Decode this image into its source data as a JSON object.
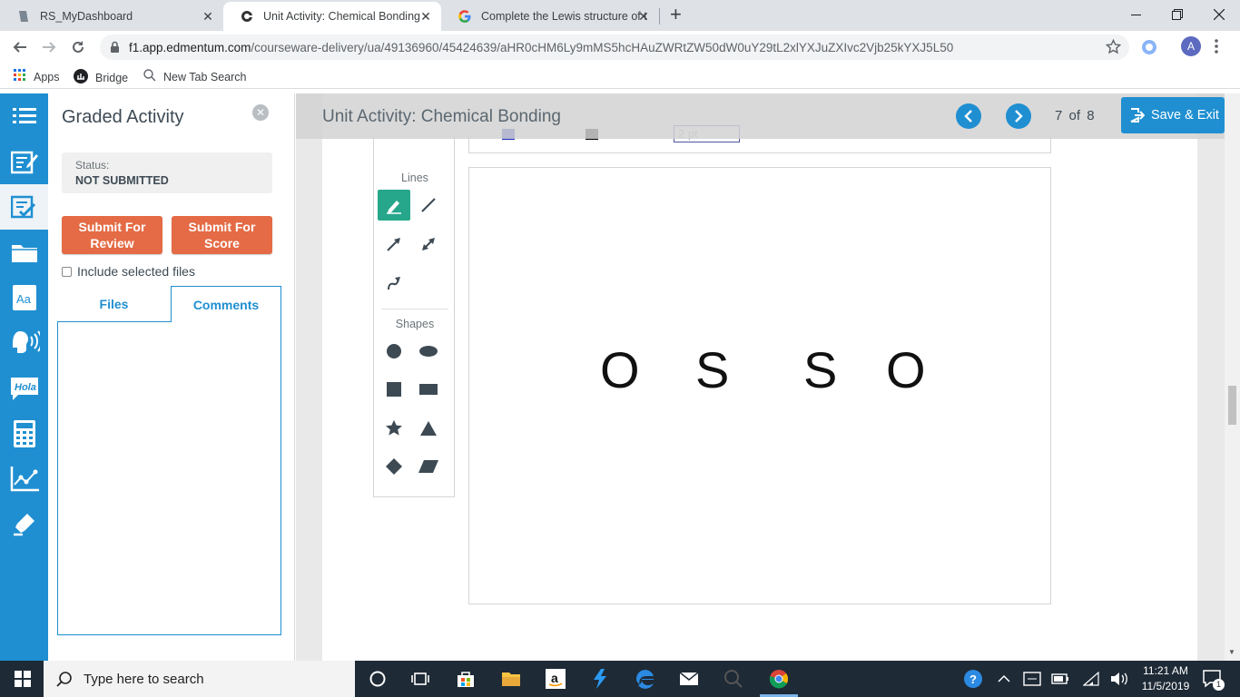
{
  "browser": {
    "tabs": [
      {
        "title": "RS_MyDashboard",
        "active": false
      },
      {
        "title": "Unit Activity: Chemical Bonding",
        "active": true
      },
      {
        "title": "Complete the Lewis structure of t",
        "active": false
      }
    ],
    "url_host": "f1.app.edmentum.com",
    "url_path": "/courseware-delivery/ua/49136960/45424639/aHR0cHM6Ly9mMS5hcHAuZWRtZW50dW0uY29tL2xlYXJuZXIvc2Vjb25kYXJ5L50",
    "profile_initial": "A",
    "bookmarks": [
      {
        "label": "Apps",
        "icon": "apps-grid-icon"
      },
      {
        "label": "Bridge",
        "icon": "bridge-icon"
      },
      {
        "label": "New Tab Search",
        "icon": "search-icon"
      }
    ]
  },
  "panel": {
    "title": "Graded Activity",
    "status_label": "Status:",
    "status_value": "NOT SUBMITTED",
    "submit_review": "Submit For Review",
    "submit_score": "Submit For Score",
    "include_files": "Include selected files",
    "tab_files": "Files",
    "tab_comments": "Comments"
  },
  "header": {
    "unit_title": "Unit Activity: Chemical Bonding",
    "page_current": "7",
    "page_of": "of",
    "page_total": "8",
    "save_exit": "Save & Exit"
  },
  "palette": {
    "lines_label": "Lines",
    "shapes_label": "Shapes"
  },
  "draw_toolbar": {
    "width_value": "2 pt"
  },
  "canvas": {
    "atoms": [
      "O",
      "S",
      "S",
      "O"
    ]
  },
  "taskbar": {
    "search_placeholder": "Type here to search",
    "time": "11:21 AM",
    "date": "11/5/2019",
    "notification_count": "1"
  },
  "colors": {
    "accent_blue": "#1f8fd1",
    "submit_orange": "#e46b45",
    "tool_selected_green": "#26a68a"
  }
}
